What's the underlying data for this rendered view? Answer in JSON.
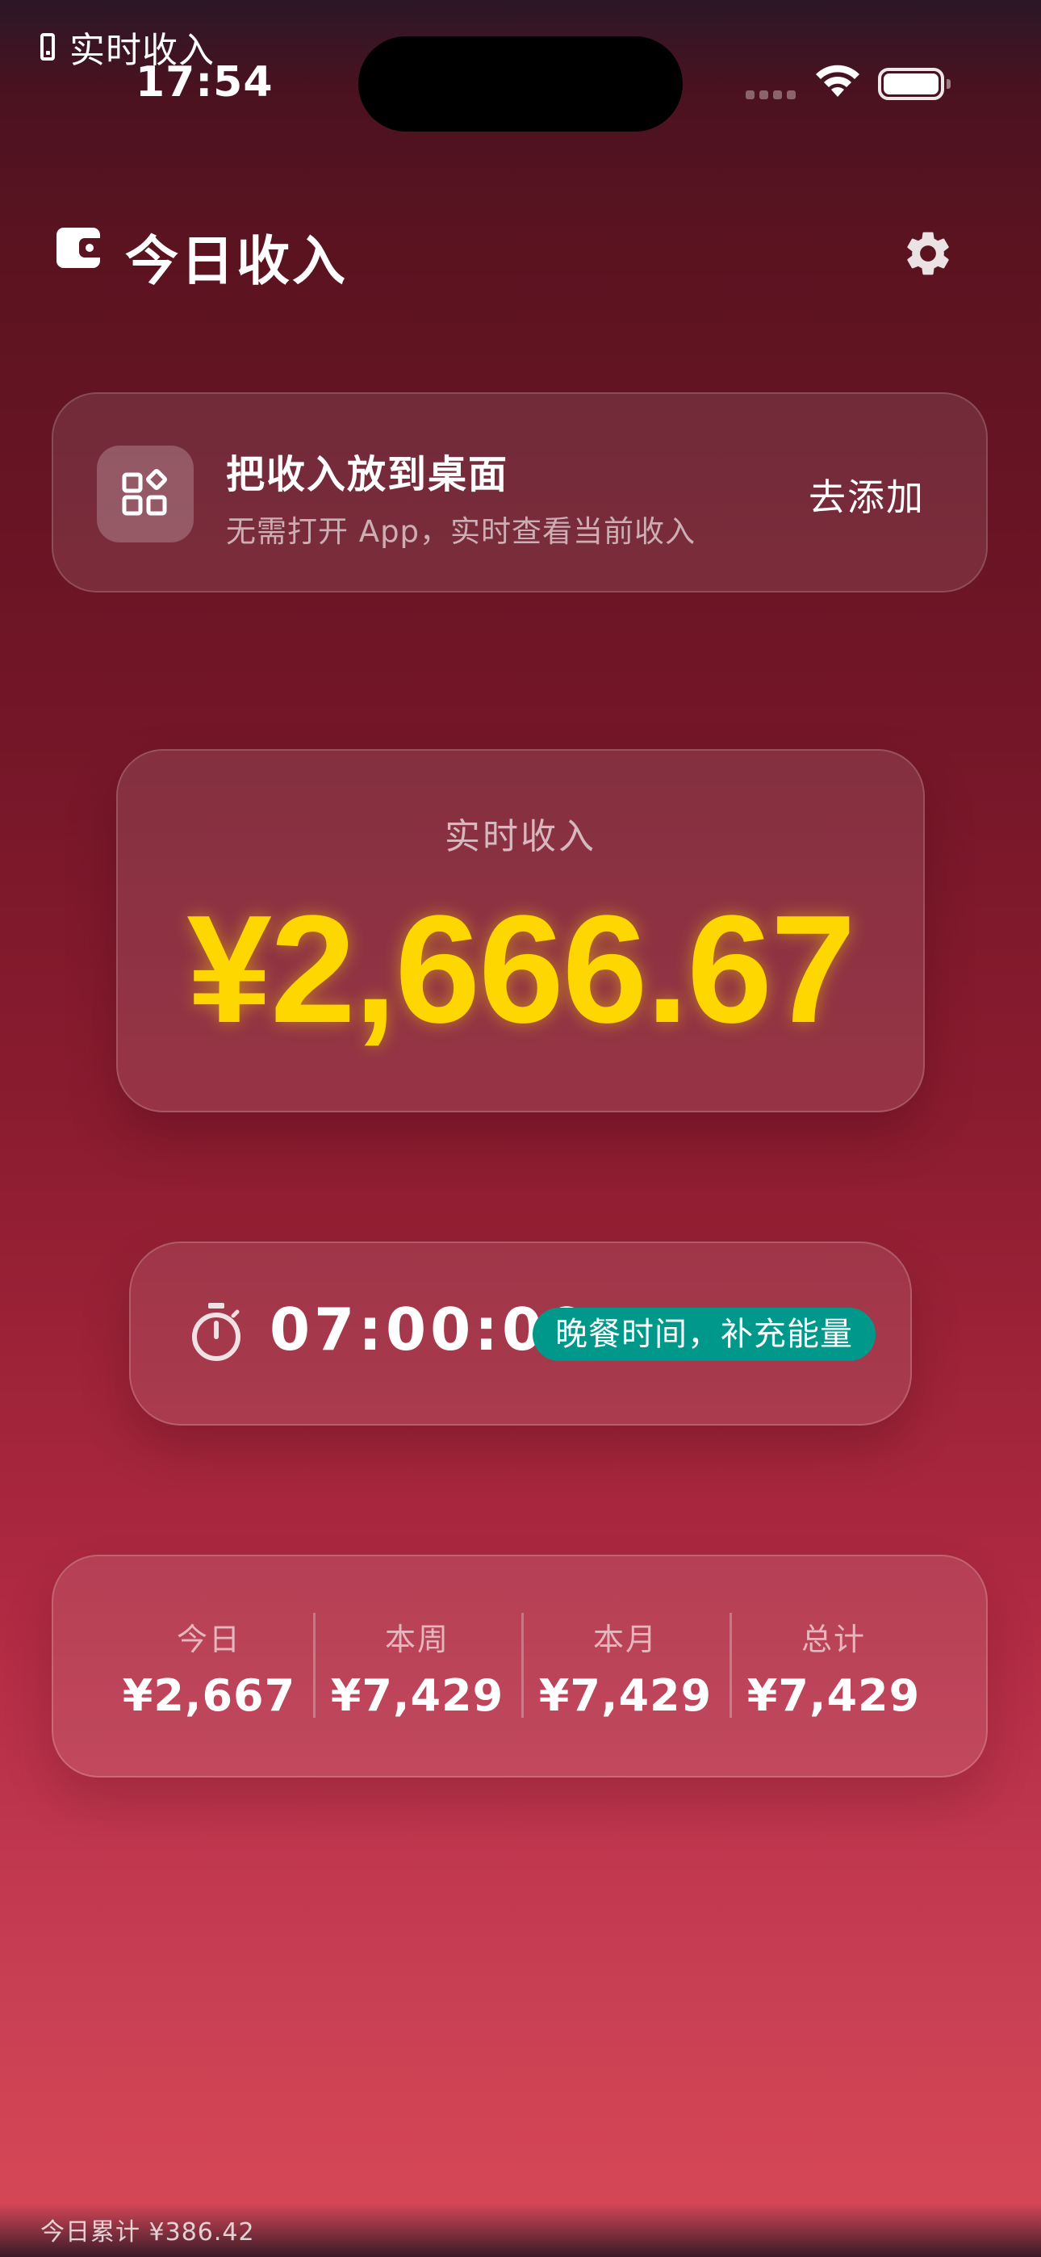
{
  "status_bar": {
    "live_activity_title": "实时收入",
    "time": "17:54"
  },
  "header": {
    "title": "今日收入",
    "icons": {
      "wallet": "wallet-icon",
      "settings": "gear-icon"
    }
  },
  "widget_promo": {
    "title": "把收入放到桌面",
    "subtitle": "无需打开 App，实时查看当前收入",
    "action_label": "去添加",
    "icon": "widgets-icon"
  },
  "income": {
    "label": "实时收入",
    "value": "¥2,666.67"
  },
  "timer": {
    "value": "07:00:00",
    "badge": "晚餐时间，补充能量",
    "icon": "stopwatch-icon"
  },
  "stats": [
    {
      "label": "今日",
      "value": "¥2,667"
    },
    {
      "label": "本周",
      "value": "¥7,429"
    },
    {
      "label": "本月",
      "value": "¥7,429"
    },
    {
      "label": "总计",
      "value": "¥7,429"
    }
  ],
  "footer": {
    "text": "今日累计 ¥386.42"
  },
  "colors": {
    "accent_gold": "#ffd700",
    "badge_green": "#00988a"
  }
}
